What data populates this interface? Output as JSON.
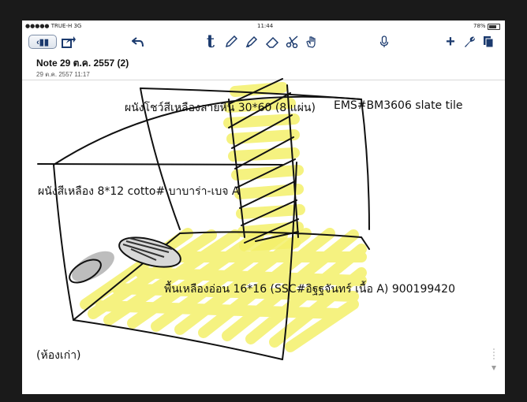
{
  "status": {
    "carrier": "●●●●● TRUE-H  3G",
    "time": "11:44",
    "battery": "78%"
  },
  "toolbar": {
    "back_icon": "notebooks-icon",
    "share_icon": "share-icon",
    "undo_icon": "undo-icon",
    "text_icon": "text-tool-icon",
    "pen_icon": "pen-icon",
    "highlighter_icon": "highlighter-icon",
    "eraser_icon": "eraser-icon",
    "scissors_icon": "scissors-icon",
    "hand_icon": "hand-icon",
    "mic_icon": "microphone-icon",
    "add_icon": "plus-icon",
    "tools_icon": "wrench-icon",
    "pages_icon": "pages-icon"
  },
  "note": {
    "title": "Note 29 ต.ค. 2557 (2)",
    "date": "29 ต.ค. 2557 11:17"
  },
  "annotations": {
    "wall_tile": "ผนังโชว์สีเหลืองลายหิน 30*60 (8 แผ่น)",
    "ems_tile": "EMS#BM3606 slate tile",
    "wall_yellow": "ผนังสีเหลือง 8*12 cotto# บาบาร่า-เบจ A",
    "floor": "พื้นเหลืองอ่อน 16*16 (SSC#อิฐฐจันทร์ เนื้อ A) 900199420",
    "old_room": "(ห้องเก่า)"
  },
  "colors": {
    "ink": "#111111",
    "highlight": "#f3f06a",
    "toolbar": "#1b3a6e"
  }
}
